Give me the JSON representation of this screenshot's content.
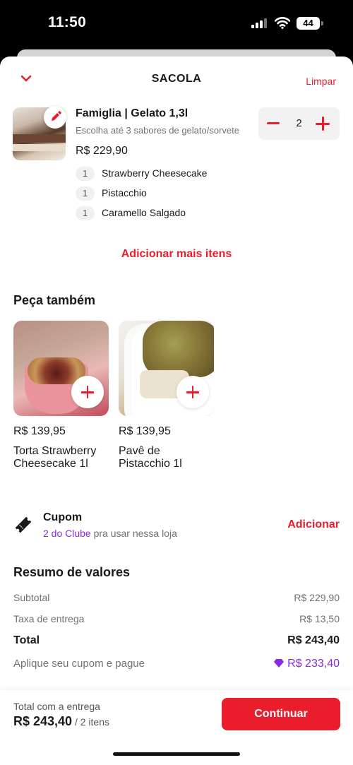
{
  "status_bar": {
    "time": "11:50",
    "battery": "44"
  },
  "header": {
    "title": "SACOLA",
    "clear_label": "Limpar"
  },
  "cart_item": {
    "name": "Famiglia | Gelato 1,3l",
    "description": "Escolha até 3 sabores de gelato/sorvete",
    "price": "R$ 229,90",
    "quantity": "2",
    "flavors": [
      {
        "qty": "1",
        "name": "Strawberry Cheesecake"
      },
      {
        "qty": "1",
        "name": "Pistacchio"
      },
      {
        "qty": "1",
        "name": "Caramello Salgado"
      }
    ]
  },
  "add_more_label": "Adicionar mais itens",
  "suggestions": {
    "title": "Peça também",
    "items": [
      {
        "price": "R$ 139,95",
        "name": "Torta Strawberry Cheesecake 1l"
      },
      {
        "price": "R$ 139,95",
        "name": "Pavê de Pistacchio 1l"
      }
    ]
  },
  "coupon": {
    "title": "Cupom",
    "club_link": "2 do Clube",
    "subtitle_rest": " pra usar nessa loja",
    "add_label": "Adicionar"
  },
  "summary": {
    "title": "Resumo de valores",
    "subtotal_label": "Subtotal",
    "subtotal_value": "R$ 229,90",
    "delivery_label": "Taxa de entrega",
    "delivery_value": "R$ 13,50",
    "total_label": "Total",
    "total_value": "R$ 243,40",
    "apply_label": "Aplique seu cupom e pague",
    "apply_value": "R$ 233,40"
  },
  "footer": {
    "label": "Total com a entrega",
    "total": "R$ 243,40",
    "count": " / 2 itens",
    "continue_label": "Continuar"
  },
  "colors": {
    "accent": "#ea1d2c",
    "club": "#8a2be2",
    "muted": "#717171"
  }
}
